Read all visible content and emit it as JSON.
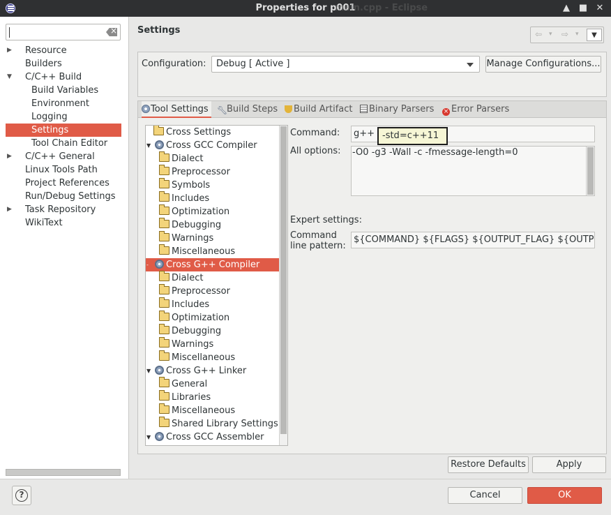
{
  "window": {
    "title": "Properties for p001",
    "ghost_title": "main.cpp - Eclipse",
    "controls": {
      "minimize": "▲",
      "maximize": "■",
      "close": "✕"
    }
  },
  "sidebar": {
    "filter_value": "",
    "items": [
      {
        "label": "Resource",
        "level": 1,
        "arrow": "▶"
      },
      {
        "label": "Builders",
        "level": 1,
        "arrow": ""
      },
      {
        "label": "C/C++ Build",
        "level": 1,
        "arrow": "▼"
      },
      {
        "label": "Build Variables",
        "level": 2,
        "arrow": ""
      },
      {
        "label": "Environment",
        "level": 2,
        "arrow": ""
      },
      {
        "label": "Logging",
        "level": 2,
        "arrow": ""
      },
      {
        "label": "Settings",
        "level": 2,
        "arrow": "",
        "selected": true
      },
      {
        "label": "Tool Chain Editor",
        "level": 2,
        "arrow": ""
      },
      {
        "label": "C/C++ General",
        "level": 1,
        "arrow": "▶"
      },
      {
        "label": "Linux Tools Path",
        "level": 1,
        "arrow": ""
      },
      {
        "label": "Project References",
        "level": 1,
        "arrow": ""
      },
      {
        "label": "Run/Debug Settings",
        "level": 1,
        "arrow": ""
      },
      {
        "label": "Task Repository",
        "level": 1,
        "arrow": "▶"
      },
      {
        "label": "WikiText",
        "level": 1,
        "arrow": ""
      }
    ]
  },
  "page": {
    "title": "Settings",
    "nav": {
      "back": "⇦",
      "forward": "⇨",
      "dropdown": "▾",
      "menu": "▼"
    }
  },
  "config": {
    "label": "Configuration:",
    "selected": "Debug  [ Active ]",
    "manage_button": "Manage Configurations..."
  },
  "tabs": [
    {
      "label": "Tool Settings",
      "icon": "gear-icon",
      "active": true
    },
    {
      "label": "Build Steps",
      "icon": "wrench-icon"
    },
    {
      "label": "Build Artifact",
      "icon": "trophy-icon"
    },
    {
      "label": "Binary Parsers",
      "icon": "binary-icon"
    },
    {
      "label": "Error Parsers",
      "icon": "error-icon"
    }
  ],
  "tool_tree": [
    {
      "label": "Cross Settings",
      "kind": "folder",
      "indent": 1
    },
    {
      "label": "Cross GCC Compiler",
      "kind": "gear",
      "indent": 0,
      "arrow": "▼"
    },
    {
      "label": "Dialect",
      "kind": "folder",
      "indent": 2
    },
    {
      "label": "Preprocessor",
      "kind": "folder",
      "indent": 2
    },
    {
      "label": "Symbols",
      "kind": "folder",
      "indent": 2
    },
    {
      "label": "Includes",
      "kind": "folder",
      "indent": 2
    },
    {
      "label": "Optimization",
      "kind": "folder",
      "indent": 2
    },
    {
      "label": "Debugging",
      "kind": "folder",
      "indent": 2
    },
    {
      "label": "Warnings",
      "kind": "folder",
      "indent": 2
    },
    {
      "label": "Miscellaneous",
      "kind": "folder",
      "indent": 2
    },
    {
      "label": "Cross G++ Compiler",
      "kind": "gear",
      "indent": 0,
      "arrow": "-",
      "selected": true
    },
    {
      "label": "Dialect",
      "kind": "folder",
      "indent": 2
    },
    {
      "label": "Preprocessor",
      "kind": "folder",
      "indent": 2
    },
    {
      "label": "Includes",
      "kind": "folder",
      "indent": 2
    },
    {
      "label": "Optimization",
      "kind": "folder",
      "indent": 2
    },
    {
      "label": "Debugging",
      "kind": "folder",
      "indent": 2
    },
    {
      "label": "Warnings",
      "kind": "folder",
      "indent": 2
    },
    {
      "label": "Miscellaneous",
      "kind": "folder",
      "indent": 2
    },
    {
      "label": "Cross G++ Linker",
      "kind": "gear",
      "indent": 0,
      "arrow": "▼"
    },
    {
      "label": "General",
      "kind": "folder",
      "indent": 2
    },
    {
      "label": "Libraries",
      "kind": "folder",
      "indent": 2
    },
    {
      "label": "Miscellaneous",
      "kind": "folder",
      "indent": 2
    },
    {
      "label": "Shared Library Settings",
      "kind": "folder",
      "indent": 2
    },
    {
      "label": "Cross GCC Assembler",
      "kind": "gear",
      "indent": 0,
      "arrow": "▼"
    }
  ],
  "form": {
    "command_label": "Command:",
    "command_value": "g++",
    "all_options_label": "All options:",
    "all_options_value": "-O0 -g3 -Wall -c -fmessage-length=0",
    "tooltip_value": "-std=c++11",
    "expert_label": "Expert settings:",
    "pattern_label_1": "Command",
    "pattern_label_2": "line pattern:",
    "pattern_value": "${COMMAND} ${FLAGS} ${OUTPUT_FLAG} ${OUTPUT_PREFIX}${OUTPUT} ${INPUTS}"
  },
  "buttons": {
    "restore_defaults": "Restore Defaults",
    "apply": "Apply",
    "cancel": "Cancel",
    "ok": "OK",
    "help": "?"
  },
  "colors": {
    "accent": "#e05b47",
    "tooltip_bg": "#f6f6d5"
  }
}
